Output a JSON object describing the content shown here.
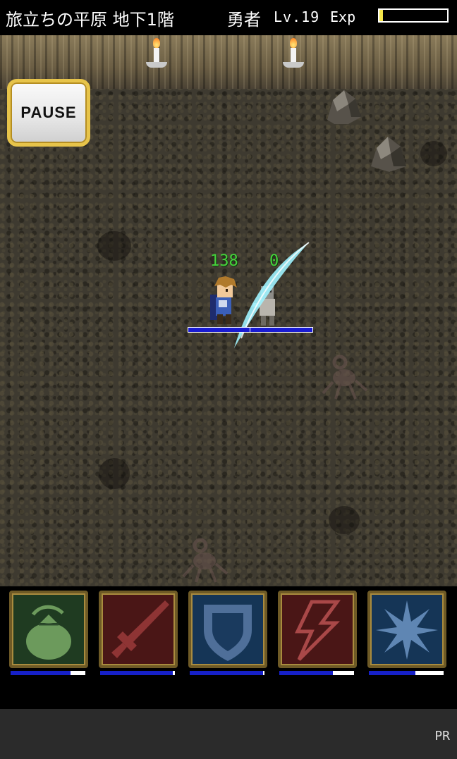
{
  "status": {
    "location": "旅立ちの平原 地下1階",
    "hero": "勇者",
    "level": "Lv.19",
    "exp_label": "Exp",
    "exp_progress": 0.05,
    "exp_fill_color": "#f4e64a"
  },
  "pause_label": "PAUSE",
  "battle": {
    "player_damage": "138",
    "enemy_damage": "0",
    "player_hp": 0.8,
    "enemy_hp": 0.82,
    "hp_color": "#1a1cd2",
    "slash_color": "#9ff3ff"
  },
  "skills": [
    {
      "icon": "item-bag-icon",
      "bg": "#1f3b21",
      "cooldown": 0.8
    },
    {
      "icon": "sword-icon",
      "bg": "#4a1616",
      "cooldown": 0.97
    },
    {
      "icon": "shield-icon",
      "bg": "#153556",
      "cooldown": 0.98
    },
    {
      "icon": "lightning-icon",
      "bg": "#4a1616",
      "cooldown": 0.72
    },
    {
      "icon": "burst-icon",
      "bg": "#153556",
      "cooldown": 0.62
    }
  ],
  "ad": {
    "label": "PR"
  }
}
